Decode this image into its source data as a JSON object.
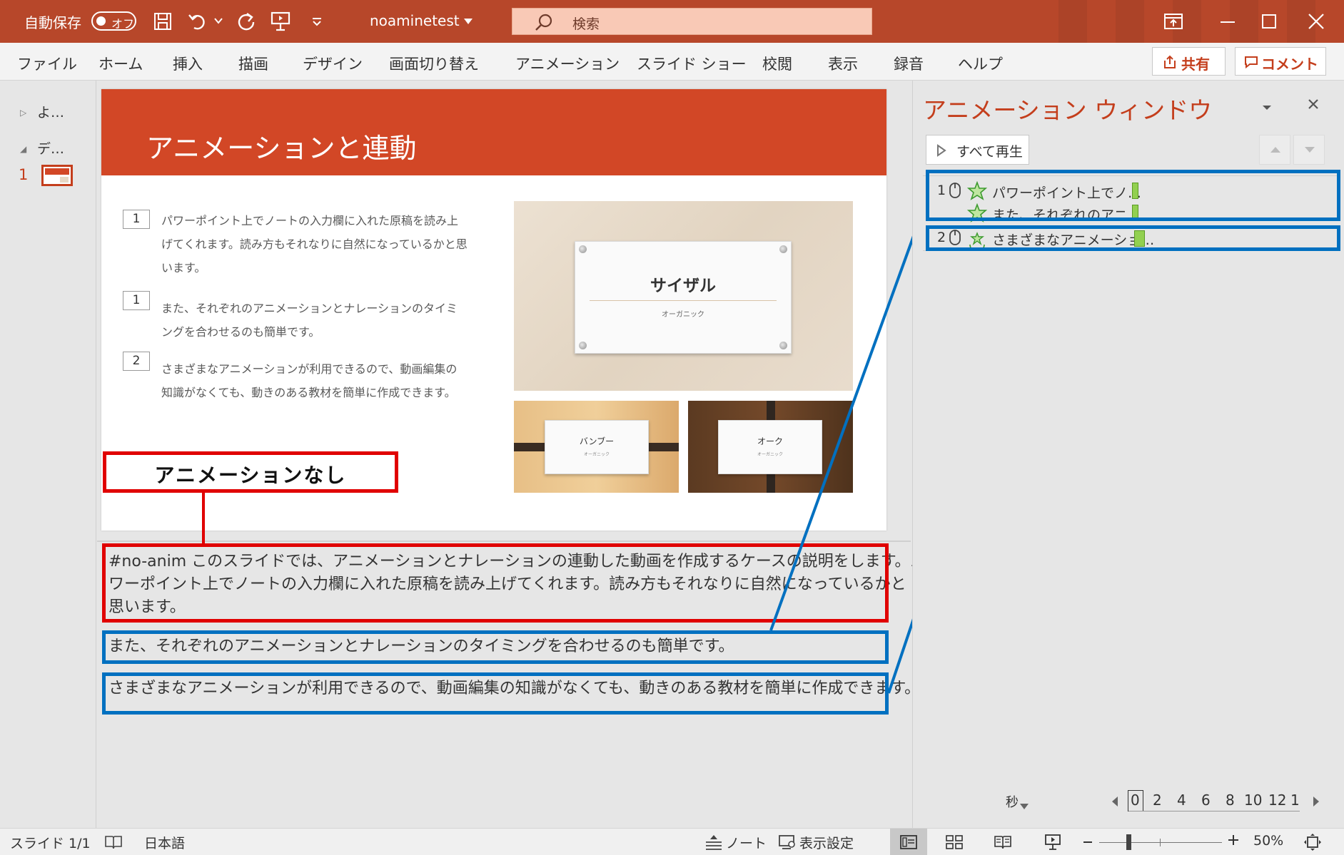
{
  "titlebar": {
    "autosave_label": "自動保存",
    "autosave_toggle": "オフ",
    "filename": "noaminetest",
    "search_placeholder": "検索"
  },
  "menu": {
    "items": [
      "ファイル",
      "ホーム",
      "挿入",
      "描画",
      "デザイン",
      "画面切り替え",
      "アニメーション",
      "スライド ショー",
      "校閲",
      "表示",
      "録音",
      "ヘルプ"
    ],
    "share": "共有",
    "comment": "コメント"
  },
  "thumbs": {
    "section1": "よ…",
    "section2": "デ…",
    "slide_number": "1"
  },
  "slide": {
    "title": "アニメーションと連動",
    "items": [
      {
        "num": "1",
        "text": "パワーポイント上でノートの入力欄に入れた原稿を読み上げてくれます。読み方もそれなりに自然になっているかと思います。"
      },
      {
        "num": "1",
        "text": "また、それぞれのアニメーションとナレーションのタイミングを合わせるのも簡単です。"
      },
      {
        "num": "2",
        "text": "さまざまなアニメーションが利用できるので、動画編集の知識がなくても、動きのある教材を簡単に作成できます。"
      }
    ],
    "photo_main_title": "サイザル",
    "photo_main_sub": "オーガニック",
    "photo_s1_title": "バンブー",
    "photo_s1_sub": "オーガニック",
    "photo_s2_title": "オーク",
    "photo_s2_sub": "オーガニック"
  },
  "annotation": {
    "no_anim_label": "アニメーションなし"
  },
  "notes": {
    "lines": [
      "#no-anim このスライドでは、アニメーションとナレーションの連動した動画を作成するケースの説明をします。パ",
      "ワーポイント上でノートの入力欄に入れた原稿を読み上げてくれます。読み方もそれなりに自然になっているかと",
      "思います。",
      "また、それぞれのアニメーションとナレーションのタイミングを合わせるのも簡単です。",
      "さまざまなアニメーションが利用できるので、動画編集の知識がなくても、動きのある教材を簡単に作成できます。"
    ]
  },
  "animpane": {
    "title": "アニメーション ウィンドウ",
    "play_all": "すべて再生",
    "rows": [
      {
        "num": "1",
        "text": "パワーポイント上でノ…"
      },
      {
        "num": "",
        "text": "また、それぞれのアニ…"
      },
      {
        "num": "2",
        "text": "さまざまなアニメーショ…"
      }
    ],
    "seconds_label": "秒",
    "timeline": [
      "0",
      "2",
      "4",
      "6",
      "8",
      "10",
      "12",
      "1"
    ]
  },
  "status": {
    "slide_pos": "スライド 1/1",
    "language": "日本語",
    "notes_btn": "ノート",
    "display_settings": "表示設定",
    "zoom": "50%"
  },
  "colors": {
    "accent": "#b7472a",
    "slide_title_band": "#d24726",
    "annotation_red": "#e00000",
    "annotation_blue": "#0070c0"
  }
}
